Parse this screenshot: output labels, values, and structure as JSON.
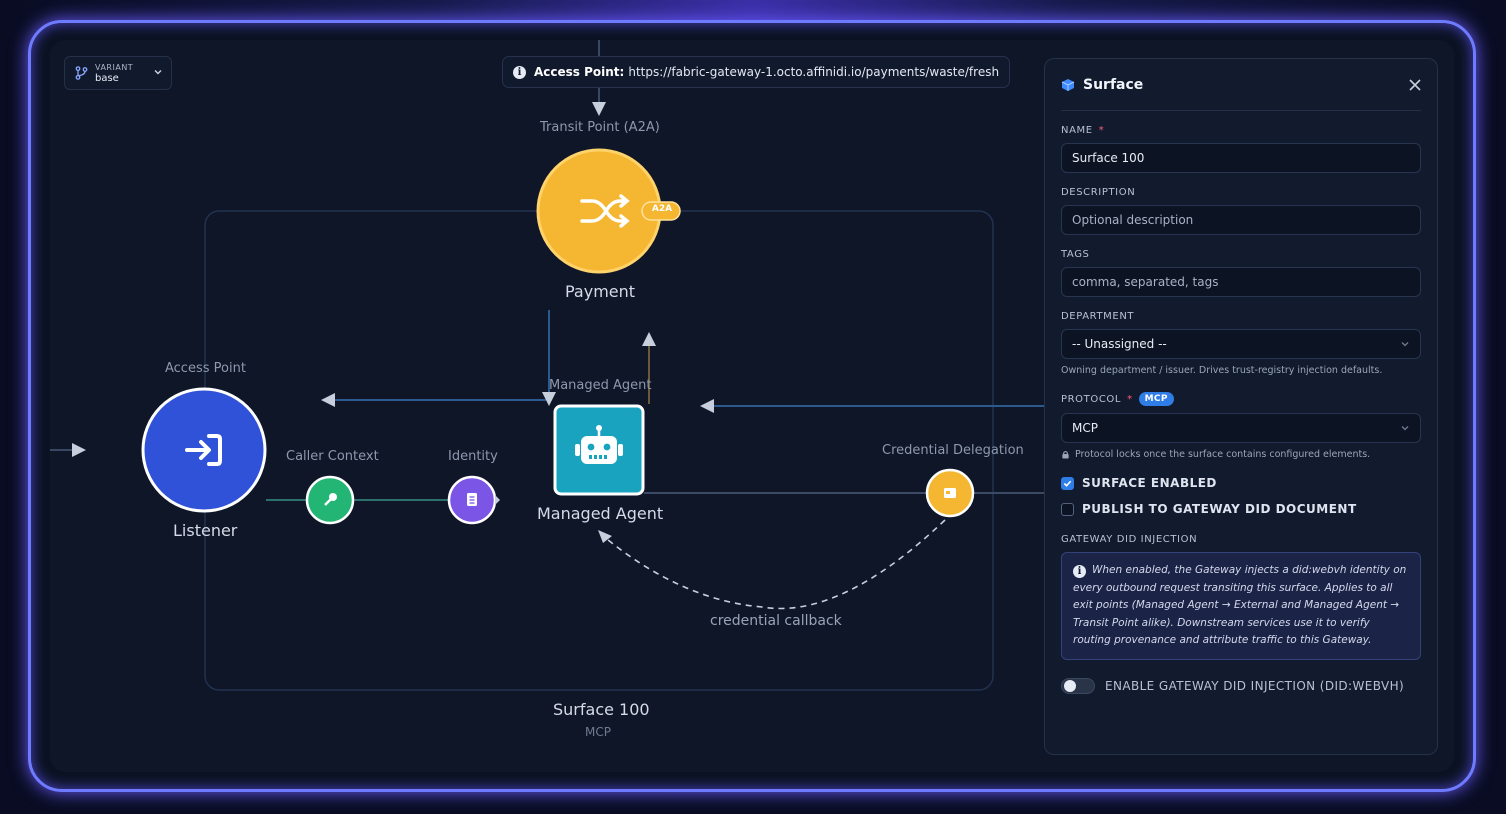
{
  "variant": {
    "label": "VARIANT",
    "value": "base"
  },
  "access_bar": {
    "label": "Access Point:",
    "url": "https://fabric-gateway-1.octo.affinidi.io/payments/waste/fresh"
  },
  "diagram": {
    "transit_label": "Transit Point (A2A)",
    "payment_label": "Payment",
    "a2a_badge": "A2A",
    "access_point_label": "Access Point",
    "listener_label": "Listener",
    "caller_context_label": "Caller Context",
    "identity_label": "Identity",
    "managed_agent_top_label": "Managed Agent",
    "managed_agent_label": "Managed Agent",
    "credential_delegation_label": "Credential Delegation",
    "credential_callback_label": "credential callback",
    "surface_name": "Surface 100",
    "surface_protocol": "MCP",
    "colors": {
      "payment": "#f5b731",
      "listener": "#2f52d9",
      "caller_context": "#22b573",
      "identity": "#7a55e6",
      "managed_agent": "#1aa3bf",
      "credential": "#f5b731"
    }
  },
  "panel": {
    "title": "Surface",
    "name_label": "NAME",
    "name_value": "Surface 100",
    "description_label": "DESCRIPTION",
    "description_placeholder": "Optional description",
    "tags_label": "TAGS",
    "tags_placeholder": "comma, separated, tags",
    "department_label": "DEPARTMENT",
    "department_value": "-- Unassigned --",
    "department_hint": "Owning department / issuer. Drives trust-registry injection defaults.",
    "protocol_label": "PROTOCOL",
    "protocol_badge": "MCP",
    "protocol_value": "MCP",
    "protocol_hint": "Protocol locks once the surface contains configured elements.",
    "surface_enabled_label": "SURFACE ENABLED",
    "surface_enabled": true,
    "publish_label": "PUBLISH TO GATEWAY DID DOCUMENT",
    "publish_checked": false,
    "injection_section_label": "GATEWAY DID INJECTION",
    "injection_info": "When enabled, the Gateway injects a did:webvh identity on every outbound request transiting this surface. Applies to all exit points (Managed Agent → External and Managed Agent → Transit Point alike). Downstream services use it to verify routing provenance and attribute traffic to this Gateway.",
    "toggle_label": "ENABLE GATEWAY DID INJECTION (DID:WEBVH)",
    "toggle_on": false
  }
}
